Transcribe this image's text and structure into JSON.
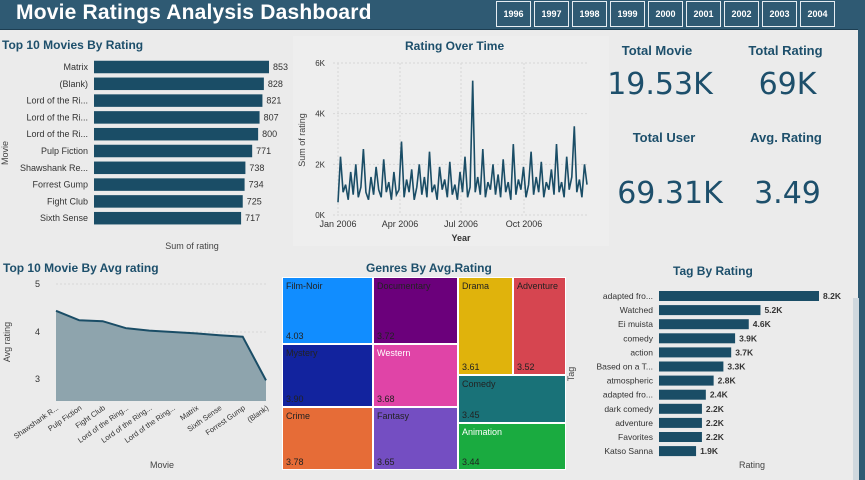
{
  "header": {
    "title": "Movie Ratings Analysis Dashboard",
    "years": [
      "1996",
      "1997",
      "1998",
      "1999",
      "2000",
      "2001",
      "2002",
      "2003",
      "2004"
    ]
  },
  "colors": {
    "header_bg": "#2f5a73",
    "bar": "#1a4d66",
    "area_fill": "#8ea4ad",
    "title_text": "#1d4f6b"
  },
  "top10_by_rating": {
    "title": "Top 10 Movies By Rating",
    "ylabel": "Movie",
    "xlabel": "Sum of rating"
  },
  "rating_over_time": {
    "title": "Rating Over Time",
    "ylabel": "Sum of rating",
    "xlabel": "Year"
  },
  "kpis": {
    "total_movie_label": "Total Movie",
    "total_movie_value": "19.53K",
    "total_rating_label": "Total Rating",
    "total_rating_value": "69K",
    "total_user_label": "Total User",
    "total_user_value": "69.31K",
    "avg_rating_label": "Avg. Rating",
    "avg_rating_value": "3.49"
  },
  "top10_by_avg": {
    "title": "Top 10 Movie By Avg rating",
    "ylabel": "Avg rating",
    "xlabel": "Movie"
  },
  "genres": {
    "title": "Genres By Avg.Rating",
    "cells": [
      {
        "label": "Film-Noir",
        "value": "4.03",
        "color": "#118dff"
      },
      {
        "label": "Documentary",
        "value": "3.72",
        "color": "#6b007b"
      },
      {
        "label": "Drama",
        "value": "3.61",
        "color": "#e0b30c"
      },
      {
        "label": "Adventure",
        "value": "3.52",
        "color": "#d64550"
      },
      {
        "label": "Mystery",
        "value": "3.90",
        "color": "#12239e"
      },
      {
        "label": "Western",
        "value": "3.68",
        "color": "#e044a7"
      },
      {
        "label": "Comedy",
        "value": "3.45",
        "color": "#197278"
      },
      {
        "label": "Crime",
        "value": "3.78",
        "color": "#e66c37"
      },
      {
        "label": "Fantasy",
        "value": "3.65",
        "color": "#744ec2"
      },
      {
        "label": "Animation",
        "value": "3.44",
        "color": "#1aab40"
      }
    ]
  },
  "tags": {
    "title": "Tag By Rating",
    "ylabel": "Tag",
    "xlabel": "Rating"
  },
  "chart_data": [
    {
      "type": "bar",
      "title": "Top 10 Movies By Rating",
      "orientation": "horizontal",
      "categories": [
        "Matrix",
        "(Blank)",
        "Lord of the Ri...",
        "Lord of the Ri...",
        "Lord of the Ri...",
        "Pulp Fiction",
        "Shawshank Re...",
        "Forrest Gump",
        "Fight Club",
        "Sixth Sense"
      ],
      "values": [
        853,
        828,
        821,
        807,
        800,
        771,
        738,
        734,
        725,
        717
      ],
      "xlabel": "Sum of rating",
      "ylabel": "Movie",
      "xlim": [
        0,
        900
      ]
    },
    {
      "type": "line",
      "title": "Rating Over Time",
      "xlabel": "Year",
      "ylabel": "Sum of rating",
      "x_ticks": [
        "Jan 2006",
        "Apr 2006",
        "Jul 2006",
        "Oct 2006"
      ],
      "y_ticks": [
        "0K",
        "2K",
        "4K",
        "6K"
      ],
      "ylim": [
        0,
        6000
      ],
      "x": [
        "2005-12-01",
        "2005-12-05",
        "2005-12-09",
        "2005-12-13",
        "2005-12-17",
        "2005-12-21",
        "2005-12-25",
        "2005-12-29",
        "2006-01-02",
        "2006-01-06",
        "2006-01-10",
        "2006-01-14",
        "2006-01-18",
        "2006-01-22",
        "2006-01-26",
        "2006-01-30",
        "2006-02-03",
        "2006-02-07",
        "2006-02-11",
        "2006-02-15",
        "2006-02-19",
        "2006-02-23",
        "2006-02-27",
        "2006-03-03",
        "2006-03-07",
        "2006-03-11",
        "2006-03-15",
        "2006-03-19",
        "2006-03-23",
        "2006-03-27",
        "2006-03-31",
        "2006-04-04",
        "2006-04-08",
        "2006-04-12",
        "2006-04-16",
        "2006-04-20",
        "2006-04-24",
        "2006-04-28",
        "2006-05-02",
        "2006-05-06",
        "2006-05-10",
        "2006-05-14",
        "2006-05-18",
        "2006-05-22",
        "2006-05-26",
        "2006-05-30",
        "2006-06-03",
        "2006-06-07",
        "2006-06-11",
        "2006-06-15",
        "2006-06-19",
        "2006-06-23",
        "2006-06-27",
        "2006-07-01",
        "2006-07-05",
        "2006-07-09",
        "2006-07-13",
        "2006-07-17",
        "2006-07-21",
        "2006-07-25",
        "2006-07-29",
        "2006-08-02",
        "2006-08-06",
        "2006-08-10",
        "2006-08-14",
        "2006-08-18",
        "2006-08-22",
        "2006-08-26",
        "2006-08-30",
        "2006-09-03",
        "2006-09-07",
        "2006-09-11",
        "2006-09-15",
        "2006-09-19",
        "2006-09-23",
        "2006-09-27",
        "2006-10-01",
        "2006-10-05",
        "2006-10-09",
        "2006-10-13",
        "2006-10-17",
        "2006-10-21",
        "2006-10-25",
        "2006-10-29",
        "2006-11-02",
        "2006-11-06",
        "2006-11-10",
        "2006-11-14",
        "2006-11-18",
        "2006-11-22",
        "2006-11-26",
        "2006-11-30",
        "2006-12-04",
        "2006-12-08",
        "2006-12-12",
        "2006-12-16",
        "2006-12-20",
        "2006-12-24",
        "2006-12-28"
      ],
      "values": [
        500,
        2300,
        900,
        1200,
        600,
        1700,
        800,
        2000,
        700,
        1100,
        2600,
        900,
        600,
        1500,
        800,
        1900,
        1000,
        700,
        2200,
        900,
        1300,
        600,
        1700,
        800,
        1000,
        2900,
        700,
        1400,
        900,
        1800,
        600,
        1100,
        2000,
        800,
        1500,
        700,
        2500,
        900,
        1200,
        600,
        1900,
        1000,
        1400,
        700,
        2100,
        800,
        1200,
        600,
        1700,
        900,
        2300,
        700,
        1100,
        5300,
        900,
        1500,
        800,
        2600,
        700,
        1300,
        1000,
        2000,
        800,
        1600,
        700,
        2200,
        900,
        1300,
        600,
        2800,
        800,
        1400,
        1000,
        1900,
        700,
        1200,
        2500,
        800,
        1500,
        900,
        2100,
        700,
        1300,
        1000,
        1800,
        800,
        2800,
        900,
        1300,
        700,
        2300,
        1000,
        1500,
        3500,
        900,
        1400,
        700,
        2000,
        1200
      ]
    },
    {
      "type": "area",
      "title": "Top 10 Movie By Avg rating",
      "xlabel": "Movie",
      "ylabel": "Avg rating",
      "categories": [
        "Shawshank R...",
        "Pulp Fiction",
        "Fight Club",
        "Lord of the Ring...",
        "Lord of the Ring...",
        "Lord of the Ring...",
        "Matrix",
        "Sixth Sense",
        "Forrest Gump",
        "(Blank)"
      ],
      "values": [
        4.45,
        4.25,
        4.23,
        4.08,
        4.03,
        4.0,
        3.97,
        3.93,
        3.9,
        2.97
      ],
      "y_ticks": [
        "3",
        "4",
        "5"
      ],
      "ylim": [
        2.7,
        5.1
      ]
    },
    {
      "type": "heatmap",
      "title": "Genres By Avg.Rating",
      "subtype": "treemap",
      "categories": [
        "Film-Noir",
        "Documentary",
        "Drama",
        "Adventure",
        "Mystery",
        "Western",
        "Comedy",
        "Crime",
        "Fantasy",
        "Animation"
      ],
      "values": [
        4.03,
        3.72,
        3.61,
        3.52,
        3.9,
        3.68,
        3.45,
        3.78,
        3.65,
        3.44
      ]
    },
    {
      "type": "bar",
      "title": "Tag By Rating",
      "orientation": "horizontal",
      "categories": [
        "adapted fro...",
        "Watched",
        "Ei muista",
        "comedy",
        "action",
        "Based on a T...",
        "atmospheric",
        "adapted fro...",
        "dark comedy",
        "adventure",
        "Favorites",
        "Katso Sanna"
      ],
      "values": [
        8200,
        5200,
        4600,
        3900,
        3700,
        3300,
        2800,
        2400,
        2200,
        2200,
        2200,
        1900
      ],
      "labels": [
        "8.2K",
        "5.2K",
        "4.6K",
        "3.9K",
        "3.7K",
        "3.3K",
        "2.8K",
        "2.4K",
        "2.2K",
        "2.2K",
        "2.2K",
        "1.9K"
      ],
      "xlabel": "Rating",
      "ylabel": "Tag",
      "xlim": [
        0,
        8200
      ]
    }
  ]
}
